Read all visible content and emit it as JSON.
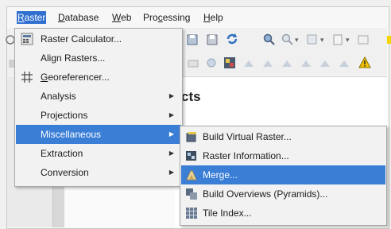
{
  "menubar": {
    "items": [
      {
        "pre": "",
        "ul": "R",
        "post": "aster"
      },
      {
        "pre": "",
        "ul": "D",
        "post": "atabase"
      },
      {
        "pre": "",
        "ul": "W",
        "post": "eb"
      },
      {
        "pre": "Pro",
        "ul": "c",
        "post": "essing"
      },
      {
        "pre": "",
        "ul": "H",
        "post": "elp"
      }
    ]
  },
  "main": {
    "heading": "cts"
  },
  "raster_menu": {
    "items": [
      {
        "label": "Raster Calculator...",
        "icon": "raster-calculator-icon"
      },
      {
        "label": "Align Rasters...",
        "icon": ""
      },
      {
        "label_ul": "G",
        "label_rest": "eoreferencer...",
        "icon": "georeferencer-icon"
      },
      {
        "label": "Analysis",
        "submenu": true
      },
      {
        "label": "Projections",
        "submenu": true
      },
      {
        "label": "Miscellaneous",
        "submenu": true,
        "highlighted": true
      },
      {
        "label": "Extraction",
        "submenu": true
      },
      {
        "label": "Conversion",
        "submenu": true
      }
    ],
    "arrow": "▶"
  },
  "misc_submenu": {
    "items": [
      {
        "label": "Build Virtual Raster...",
        "icon": "build-virtual-raster-icon"
      },
      {
        "label": "Raster Information...",
        "icon": "raster-information-icon"
      },
      {
        "label": "Merge...",
        "icon": "merge-icon",
        "highlighted": true
      },
      {
        "label": "Build Overviews (Pyramids)...",
        "icon": "build-overviews-icon"
      },
      {
        "label": "Tile Index...",
        "icon": "tile-index-icon"
      }
    ]
  },
  "colors": {
    "highlight": "#3a7ed6",
    "menubar_active": "#2f6fcf"
  }
}
